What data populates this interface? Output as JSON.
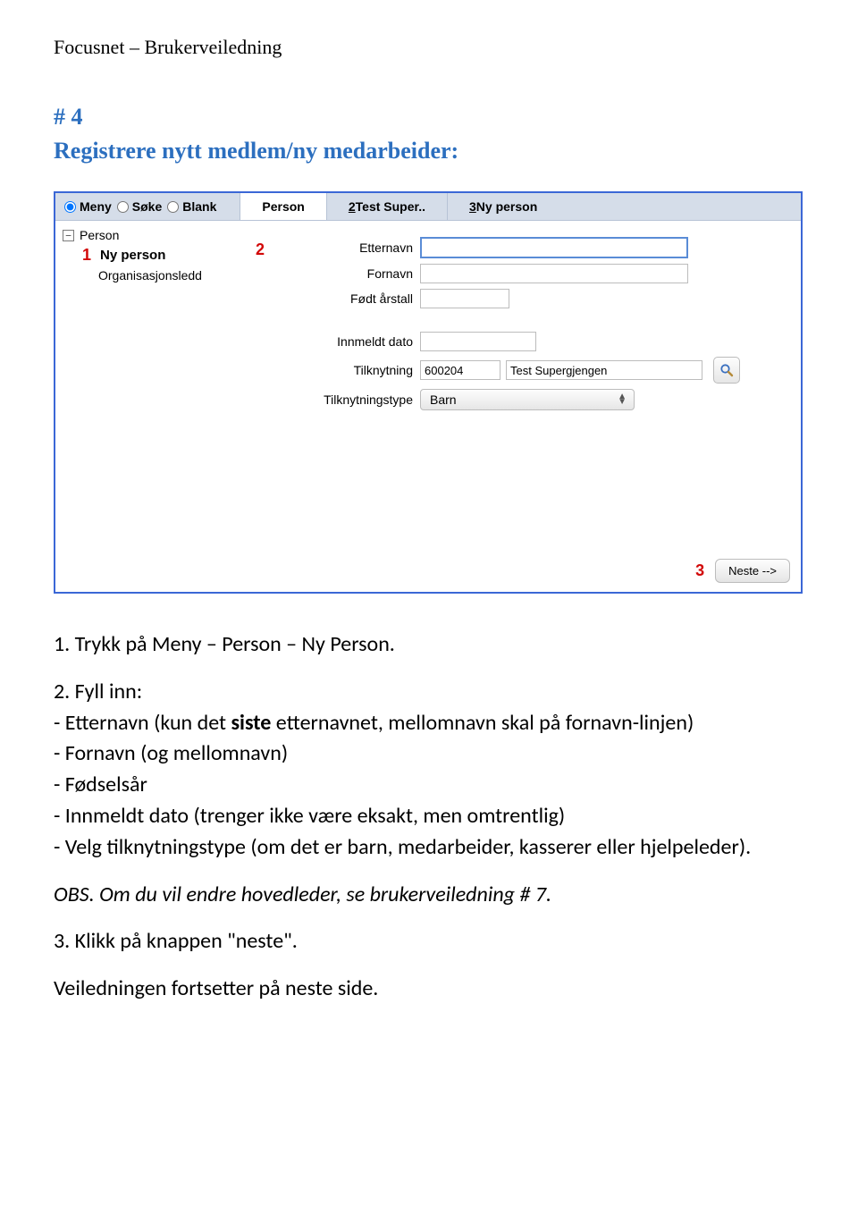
{
  "header": "Focusnet – Brukerveiledning",
  "step_number": "# 4",
  "step_title": "Registrere nytt medlem/ny medarbeider:",
  "screenshot": {
    "radios": {
      "meny": "Meny",
      "soke": "Søke",
      "blank": "Blank"
    },
    "tabs": {
      "t1": "Person",
      "t2_prefix": "2",
      "t2_rest": " Test Super..",
      "t3_prefix": "3",
      "t3_rest": " Ny person"
    },
    "sidebar": {
      "top": "Person",
      "marker1": "1",
      "nyperson": "Ny person",
      "orgledd": "Organisasjonsledd"
    },
    "form": {
      "marker2": "2",
      "etternavn": "Etternavn",
      "fornavn": "Fornavn",
      "fodt": "Født årstall",
      "innmeldt": "Innmeldt dato",
      "tilknytning": "Tilknytning",
      "tilknytning_code": "600204",
      "tilknytning_name": "Test Supergjengen",
      "tilknytningstype": "Tilknytningstype",
      "tilknytningstype_value": "Barn"
    },
    "footer": {
      "marker3": "3",
      "neste": "Neste -->"
    }
  },
  "instructions": {
    "l1": "1. Trykk på Meny – Person – Ny Person.",
    "l2_lead": "2. Fyll inn:",
    "l2_a1": "- Etternavn (kun det ",
    "l2_a1_bold": "siste",
    "l2_a1_end": " etternavnet, mellomnavn skal på fornavn-linjen)",
    "l2_b": "- Fornavn (og mellomnavn)",
    "l2_c": "- Fødselsår",
    "l2_d": "- Innmeldt dato (trenger ikke være eksakt, men omtrentlig)",
    "l2_e": "- Velg tilknytningstype (om det er barn, medarbeider, kasserer eller hjelpeleder).",
    "obs": "OBS. Om du vil endre hovedleder, se brukerveiledning # 7.",
    "l3": "3. Klikk på knappen \"neste\".",
    "cont": "Veiledningen fortsetter på neste side."
  }
}
